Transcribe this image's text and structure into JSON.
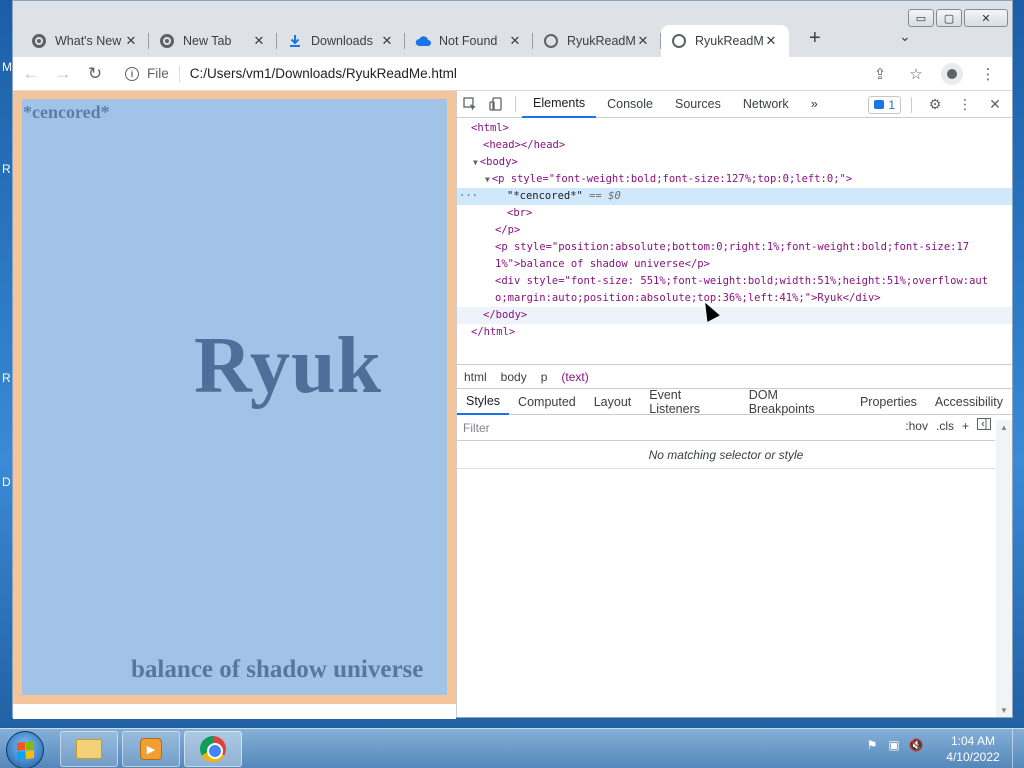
{
  "desktop": {
    "letters": [
      "M",
      "R",
      "R",
      "D"
    ]
  },
  "browser": {
    "window_controls": {
      "minimize": "▭",
      "maximize": "▢",
      "close": "✕"
    },
    "tabs": [
      {
        "title": "What's New",
        "icon": "chrome-icon"
      },
      {
        "title": "New Tab",
        "icon": "chrome-icon"
      },
      {
        "title": "Downloads",
        "icon": "download-icon"
      },
      {
        "title": "Not Found",
        "icon": "cloud-icon"
      },
      {
        "title": "RyukReadM",
        "icon": "globe-icon"
      },
      {
        "title": "RyukReadM",
        "icon": "globe-icon",
        "active": true
      }
    ],
    "new_tab": "+",
    "tab_list": "⌄",
    "close_glyph": "✕",
    "back": "←",
    "forward": "→",
    "reload": "↻",
    "scheme": "File",
    "url": "C:/Users/vm1/Downloads/RyukReadMe.html",
    "share": "⇪",
    "bookmark": "☆",
    "menu": "⋮"
  },
  "page": {
    "censored": "*cencored*",
    "ryuk": "Ryuk",
    "balance": "balance of shadow universe",
    "colors": {
      "outer": "#f4c598",
      "inner": "#a1c3e8",
      "text": "#4e6f99"
    }
  },
  "devtools": {
    "tabs": [
      "Elements",
      "Console",
      "Sources",
      "Network"
    ],
    "more": "»",
    "issues_count": "1",
    "settings": "⚙",
    "menu": "⋮",
    "close": "✕",
    "dom": [
      {
        "text": "<html>"
      },
      {
        "text": "<head></head>"
      },
      {
        "text": "<body>"
      },
      {
        "text": "<p style=\"font-weight:bold;font-size:127%;top:0;left:0;\">"
      },
      {
        "text": "\"*cencored*\"",
        "suffix": " == $0"
      },
      {
        "text": "<br>"
      },
      {
        "text": "</p>"
      },
      {
        "text": "<p style=\"position:absolute;bottom:0;right:1%;font-weight:bold;font-size:17"
      },
      {
        "text": "1%\">balance of shadow universe</p>"
      },
      {
        "text": "<div style=\"font-size: 551%;font-weight:bold;width:51%;height:51%;overflow:aut"
      },
      {
        "text": "o;margin:auto;position:absolute;top:36%;left:41%;\">Ryuk</div>"
      },
      {
        "text": "</body>"
      },
      {
        "text": "</html>"
      }
    ],
    "ellipsis": "···",
    "breadcrumbs": [
      "html",
      "body",
      "p",
      "(text)"
    ],
    "sub_tabs": [
      "Styles",
      "Computed",
      "Layout",
      "Event Listeners",
      "DOM Breakpoints",
      "Properties",
      "Accessibility"
    ],
    "filter_placeholder": "Filter",
    "hov": ":hov",
    "cls": ".cls",
    "add": "+",
    "no_match": "No matching selector or style"
  },
  "taskbar": {
    "clock_time": "1:04 AM",
    "clock_date": "4/10/2022",
    "media_glyph": "▶",
    "tray": [
      "⚑",
      "▣",
      "🔇"
    ]
  }
}
